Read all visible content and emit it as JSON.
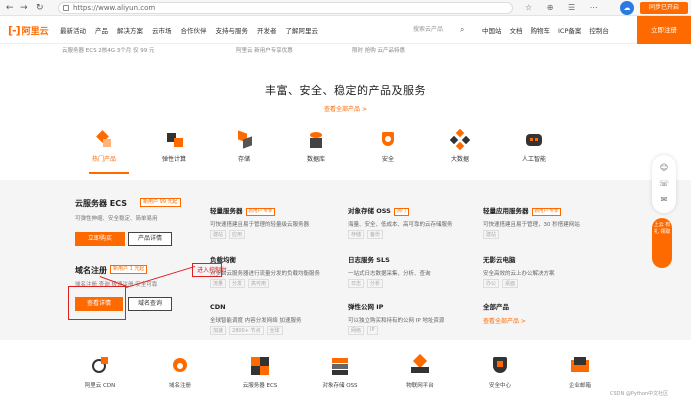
{
  "browser": {
    "nav_back": "←",
    "nav_forward": "→",
    "nav_refresh": "↻",
    "url": "https://www.aliyun.com",
    "icons": "☆ ⊕ ☰ ⋯",
    "cloud_badge": "☁",
    "login_label": "同步已开启"
  },
  "header": {
    "logo_mark": "[-]",
    "logo_name": "阿里云",
    "nav": [
      "最新活动",
      "产品",
      "解决方案",
      "云市场",
      "合作伙伴",
      "支持与服务",
      "开发者",
      "了解阿里云"
    ],
    "search_placeholder": "搜索云产品",
    "util_nav": [
      "中国站",
      "文档",
      "购物车",
      "ICP备案",
      "控制台"
    ],
    "console_label": "立即注册"
  },
  "announcement": [
    "云服务器 ECS 2核4G 3个月 仅 99 元",
    "阿里云 新用户专享优惠",
    "限时 抢购 云产品特惠"
  ],
  "section": {
    "title": "丰富、安全、稳定的产品及服务",
    "link": "查看全部产品 >"
  },
  "categories": [
    {
      "label": "热门产品",
      "active": true
    },
    {
      "label": "弹性计算",
      "active": false
    },
    {
      "label": "存储",
      "active": false
    },
    {
      "label": "数据库",
      "active": false
    },
    {
      "label": "安全",
      "active": false
    },
    {
      "label": "大数据",
      "active": false
    },
    {
      "label": "人工智能",
      "active": false
    }
  ],
  "features": [
    {
      "title": "云服务器 ECS",
      "tag": "新用户 99 元起",
      "desc": "可弹性伸缩、安全稳定、简单易用",
      "primary": "立即购买",
      "secondary": "产品详情"
    },
    {
      "title": "域名注册",
      "tag": "新用户 1 元起",
      "desc": "域名注册 查询 极速注册 安全可靠",
      "primary": "查看详情",
      "secondary": "域名查询"
    }
  ],
  "products": [
    {
      "title": "轻量服务器",
      "tag": "新用户 专享",
      "desc": "可快速搭建且易于管理的轻量级云服务器",
      "sub": [
        "建站",
        "应用"
      ]
    },
    {
      "title": "对象存储 OSS",
      "tag": "热门",
      "desc": "海量、安全、低成本、高可靠的云存储服务",
      "sub": [
        "存储",
        "备份"
      ]
    },
    {
      "title": "轻量应用服务器",
      "tag": "新用户 专享",
      "desc": "可快速搭建且易于管理，30 秒搭建网站",
      "sub": [
        "建站"
      ]
    },
    {
      "title": "负载均衡",
      "tag": "",
      "desc": "对多台云服务器进行流量分发的负载均衡服务",
      "sub": [
        "流量",
        "分发",
        "高可用"
      ]
    },
    {
      "title": "日志服务 SLS",
      "tag": "",
      "desc": "一站式日志数据采集、分析、查询",
      "sub": [
        "日志",
        "分析"
      ]
    },
    {
      "title": "无影云电脑",
      "tag": "",
      "desc": "安全高效的云上办公解决方案",
      "sub": [
        "办公",
        "桌面"
      ]
    },
    {
      "title": "CDN",
      "tag": "",
      "desc": "全球智能调度 内容分发网络 加速服务",
      "sub": [
        "加速",
        "2800+ 节点",
        "全球"
      ]
    },
    {
      "title": "弹性公网 IP",
      "tag": "",
      "desc": "可以独立购买和持有的公网 IP 地址资源",
      "sub": [
        "网络",
        "IP"
      ]
    },
    {
      "title": "全部产品",
      "tag": "",
      "desc": "",
      "sub": [],
      "link": "查看全部产品 >"
    }
  ],
  "annotations": {
    "label": "进入控制台"
  },
  "float_bar": {
    "icons": [
      "☺",
      "☏",
      "✉"
    ],
    "promo": "上云 有礼 领取"
  },
  "bottom_products": [
    "阿里云 CDN",
    "域名注册",
    "云服务器 ECS",
    "对象存储 OSS",
    "物联网平台",
    "安全中心",
    "企业邮箱"
  ],
  "watermark": "CSDN @Python中文社区",
  "colors": {
    "brand": "#ff6a00",
    "annotation": "#e02020",
    "panel_bg": "#f5f5f6"
  }
}
